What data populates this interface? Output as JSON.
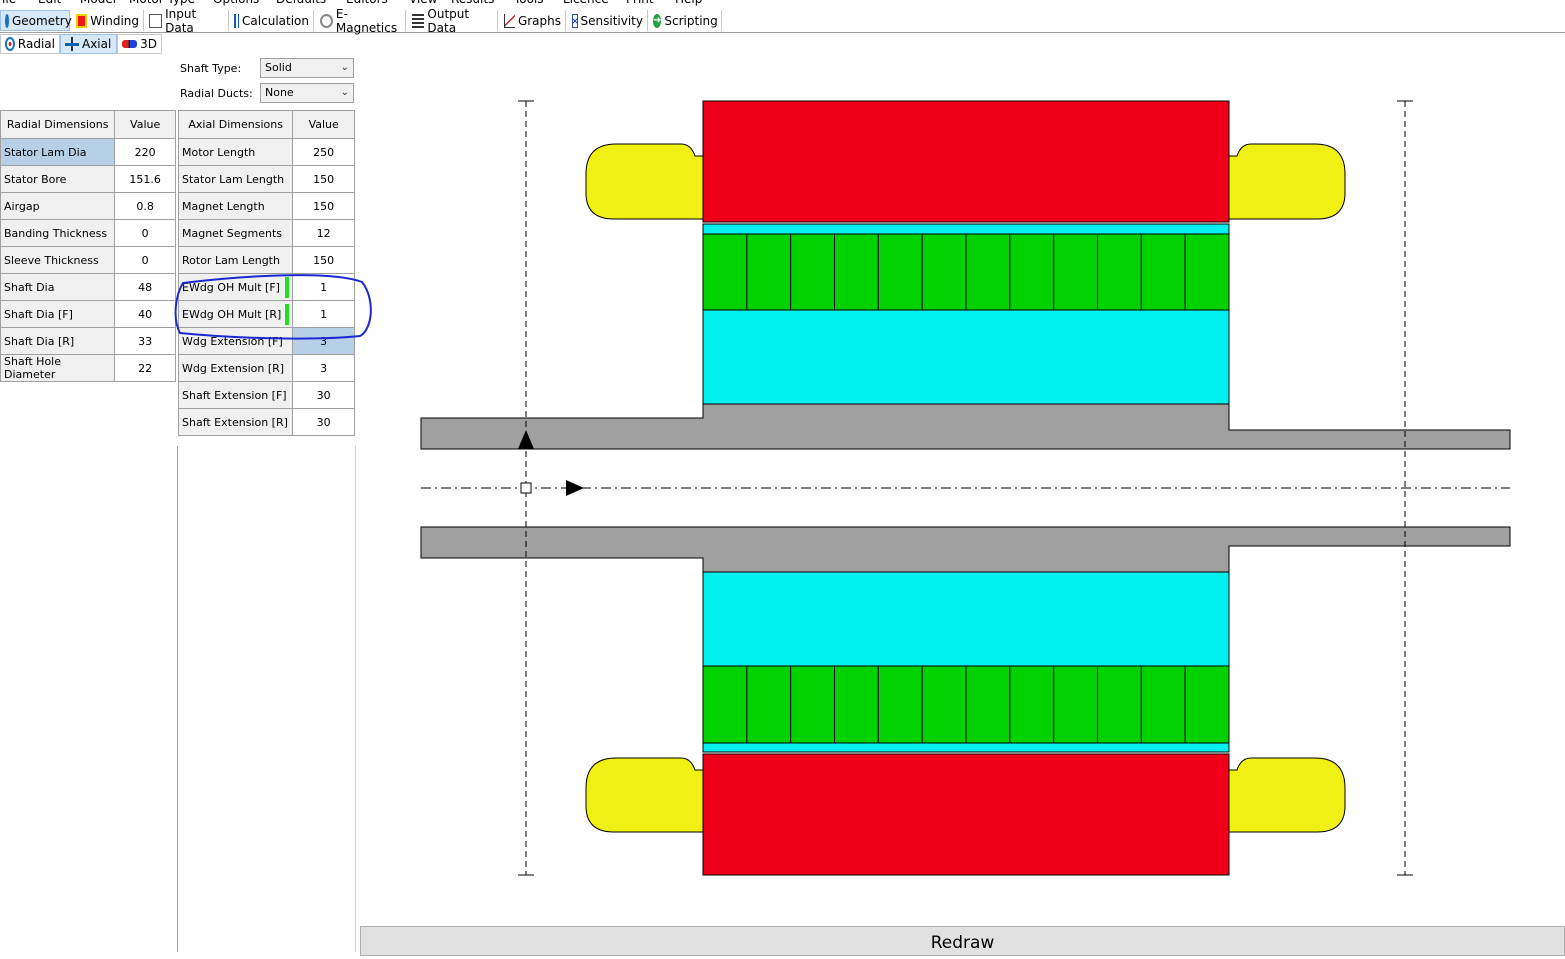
{
  "menu": [
    "File",
    "Edit",
    "Model",
    "Motor Type",
    "Options",
    "Defaults",
    "Editors",
    "View",
    "Results",
    "Tools",
    "Licence",
    "Print",
    "Help"
  ],
  "tabs": [
    {
      "label": "Geometry",
      "icon": "geometry-icon",
      "active": true
    },
    {
      "label": "Winding",
      "icon": "winding-icon"
    },
    {
      "label": "Input Data",
      "icon": "input-data-icon"
    },
    {
      "label": "Calculation",
      "icon": "calculation-icon"
    },
    {
      "label": "E-Magnetics",
      "icon": "e-magnetics-icon"
    },
    {
      "label": "Output Data",
      "icon": "output-data-icon"
    },
    {
      "label": "Graphs",
      "icon": "graphs-icon"
    },
    {
      "label": "Sensitivity",
      "icon": "sensitivity-icon"
    },
    {
      "label": "Scripting",
      "icon": "scripting-icon"
    }
  ],
  "subtabs": [
    {
      "label": "Radial",
      "icon": "radial-icon"
    },
    {
      "label": "Axial",
      "icon": "axial-icon",
      "active": true
    },
    {
      "label": "3D",
      "icon": "3d-glasses-icon"
    }
  ],
  "shaft_type": {
    "label": "Shaft Type:",
    "value": "Solid"
  },
  "radial_ducts": {
    "label": "Radial Ducts:",
    "value": "None"
  },
  "radial_table": {
    "headers": [
      "Radial Dimensions",
      "Value"
    ],
    "rows": [
      [
        "Stator Lam Dia",
        "220"
      ],
      [
        "Stator Bore",
        "151.6"
      ],
      [
        "Airgap",
        "0.8"
      ],
      [
        "Banding Thickness",
        "0"
      ],
      [
        "Sleeve Thickness",
        "0"
      ],
      [
        "Shaft Dia",
        "48"
      ],
      [
        "Shaft Dia [F]",
        "40"
      ],
      [
        "Shaft Dia [R]",
        "33"
      ],
      [
        "Shaft Hole Diameter",
        "22"
      ]
    ]
  },
  "axial_table": {
    "headers": [
      "Axial Dimensions",
      "Value"
    ],
    "rows": [
      [
        "Motor Length",
        "250"
      ],
      [
        "Stator Lam Length",
        "150"
      ],
      [
        "Magnet Length",
        "150"
      ],
      [
        "Magnet Segments",
        "12"
      ],
      [
        "Rotor Lam Length",
        "150"
      ],
      [
        "EWdg OH Mult [F]",
        "1"
      ],
      [
        "EWdg OH Mult [R]",
        "1"
      ],
      [
        "Wdg Extension [F]",
        "3"
      ],
      [
        "Wdg Extension [R]",
        "3"
      ],
      [
        "Shaft Extension [F]",
        "30"
      ],
      [
        "Shaft Extension [R]",
        "30"
      ]
    ]
  },
  "drawing": {
    "magnet_segments": 12,
    "colors": {
      "stator": "#f00018",
      "winding": "#f0f014",
      "magnet": "#00d200",
      "rotor": "#00f0f0",
      "shaft": "#a0a0a0",
      "annotation": "#1a2ad0"
    }
  },
  "redraw_label": "Redraw"
}
